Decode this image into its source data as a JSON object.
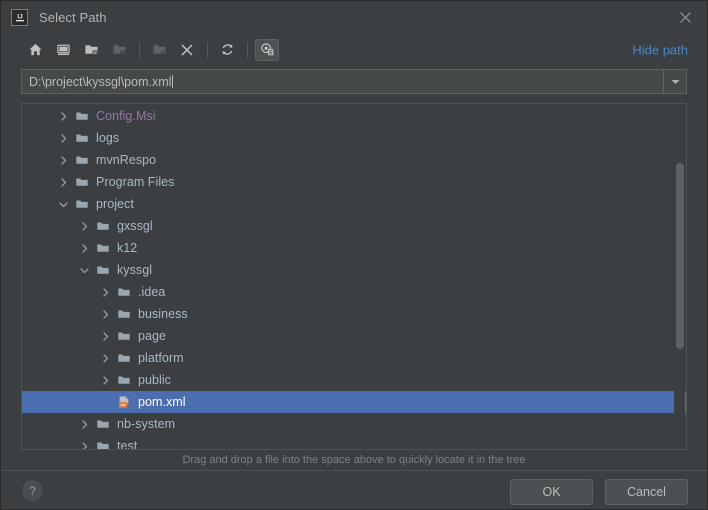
{
  "window": {
    "title": "Select Path",
    "app_icon": "intellij-idea-logo",
    "close_icon": "close-icon"
  },
  "toolbar": {
    "buttons": [
      {
        "name": "home-button",
        "icon": "home-icon",
        "tooltip": "Home",
        "enabled": true,
        "toggled": false
      },
      {
        "name": "desktop-button",
        "icon": "desktop-icon",
        "tooltip": "Desktop",
        "enabled": true,
        "toggled": false
      },
      {
        "name": "project-dir-button",
        "icon": "folder-project-icon",
        "tooltip": "Project Directory",
        "enabled": true,
        "toggled": false
      },
      {
        "name": "module-dir-button",
        "icon": "folder-module-icon",
        "tooltip": "Module Directory",
        "enabled": false,
        "toggled": false
      },
      {
        "name": "new-folder-button",
        "icon": "folder-add-icon",
        "tooltip": "New Folder",
        "enabled": false,
        "toggled": false
      },
      {
        "name": "delete-button",
        "icon": "close-x-icon",
        "tooltip": "Delete",
        "enabled": true,
        "toggled": false
      },
      {
        "name": "refresh-button",
        "icon": "refresh-icon",
        "tooltip": "Refresh",
        "enabled": true,
        "toggled": false
      },
      {
        "name": "show-hidden-button",
        "icon": "show-hidden-files-icon",
        "tooltip": "Show Hidden Files",
        "enabled": true,
        "toggled": true
      }
    ],
    "hide_path_label": "Hide path"
  },
  "path_field": {
    "value": "D:\\project\\kyssgl\\pom.xml",
    "placeholder": "",
    "dropdown_icon": "chevron-down-icon"
  },
  "tree": {
    "rows": [
      {
        "label": "Config.Msi",
        "indent": 1,
        "twisty": "collapsed",
        "icon": "folder-icon",
        "selected": false,
        "violet": true
      },
      {
        "label": "logs",
        "indent": 1,
        "twisty": "collapsed",
        "icon": "folder-icon",
        "selected": false,
        "violet": false
      },
      {
        "label": "mvnRespo",
        "indent": 1,
        "twisty": "collapsed",
        "icon": "folder-icon",
        "selected": false,
        "violet": false
      },
      {
        "label": "Program Files",
        "indent": 1,
        "twisty": "collapsed",
        "icon": "folder-icon",
        "selected": false,
        "violet": false
      },
      {
        "label": "project",
        "indent": 1,
        "twisty": "expanded",
        "icon": "folder-icon",
        "selected": false,
        "violet": false
      },
      {
        "label": "gxssgl",
        "indent": 2,
        "twisty": "collapsed",
        "icon": "folder-icon",
        "selected": false,
        "violet": false
      },
      {
        "label": "k12",
        "indent": 2,
        "twisty": "collapsed",
        "icon": "folder-icon",
        "selected": false,
        "violet": false
      },
      {
        "label": "kyssgl",
        "indent": 2,
        "twisty": "expanded",
        "icon": "folder-icon",
        "selected": false,
        "violet": false
      },
      {
        "label": ".idea",
        "indent": 3,
        "twisty": "collapsed",
        "icon": "folder-icon",
        "selected": false,
        "violet": false
      },
      {
        "label": "business",
        "indent": 3,
        "twisty": "collapsed",
        "icon": "folder-icon",
        "selected": false,
        "violet": false
      },
      {
        "label": "page",
        "indent": 3,
        "twisty": "collapsed",
        "icon": "folder-icon",
        "selected": false,
        "violet": false
      },
      {
        "label": "platform",
        "indent": 3,
        "twisty": "collapsed",
        "icon": "folder-icon",
        "selected": false,
        "violet": false
      },
      {
        "label": "public",
        "indent": 3,
        "twisty": "collapsed",
        "icon": "folder-icon",
        "selected": false,
        "violet": false
      },
      {
        "label": "pom.xml",
        "indent": 3,
        "twisty": "none",
        "icon": "maven-xml-icon",
        "selected": true,
        "violet": false
      },
      {
        "label": "nb-system",
        "indent": 2,
        "twisty": "collapsed",
        "icon": "folder-icon",
        "selected": false,
        "violet": false
      },
      {
        "label": "test",
        "indent": 2,
        "twisty": "collapsed",
        "icon": "folder-icon",
        "selected": false,
        "violet": false
      },
      {
        "label": "",
        "indent": 2,
        "twisty": "collapsed",
        "icon": "folder-icon",
        "selected": false,
        "violet": false
      }
    ],
    "scrollbar": {
      "thumb_top_pct": 17,
      "thumb_height_pct": 54
    }
  },
  "hint": {
    "text": "Drag and drop a file into the space above to quickly locate it in the tree"
  },
  "footer": {
    "help_label": "?",
    "ok_label": "OK",
    "cancel_label": "Cancel"
  },
  "colors": {
    "background": "#3c3f41",
    "selection": "#4b6eaf",
    "link": "#4a88c7",
    "folder": "#9aa7b0",
    "text": "#a9b7c6",
    "violet_text": "#9876aa",
    "maven_orange": "#e8743b"
  }
}
